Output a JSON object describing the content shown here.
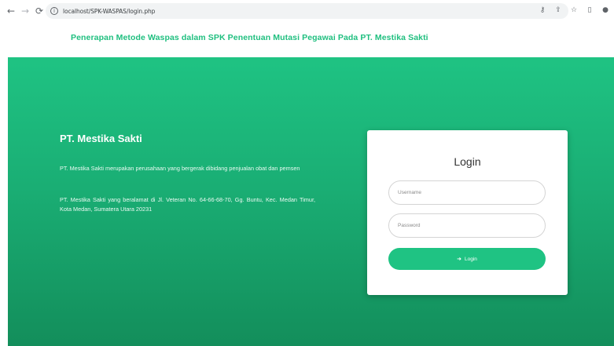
{
  "browser": {
    "url": "localhost/SPK-WASPAS/login.php",
    "icons": [
      "back-arrow-icon",
      "forward-arrow-icon",
      "reload-icon",
      "info-icon",
      "key-icon",
      "share-icon",
      "star-icon",
      "sidebar-icon",
      "profile-icon"
    ]
  },
  "header": {
    "title": "Penerapan Metode Waspas dalam SPK Penentuan Mutasi Pegawai Pada PT. Mestika Sakti"
  },
  "hero": {
    "company_name": "PT. Mestika Sakti",
    "description_1": "PT. Mestika Sakti merupakan perusahaan yang bergerak dibidang penjualan obat dan pemsen",
    "description_2": "PT. Mestika Sakti yang beralamat di Jl. Veteran No. 64-66-68-70, Gg. Buntu, Kec. Medan Timur, Kota Medan, Sumatera Utara 20231"
  },
  "login": {
    "title": "Login",
    "username_placeholder": "Username",
    "password_placeholder": "Password",
    "button_label": "Login"
  },
  "colors": {
    "accent": "#1fc383",
    "hero_top": "#1fc383",
    "hero_bottom": "#138e5b"
  }
}
